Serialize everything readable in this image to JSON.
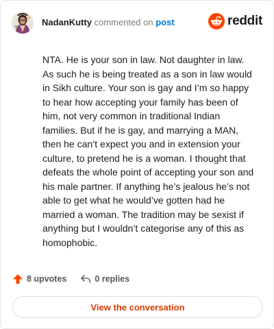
{
  "header": {
    "username": "NadanKutty",
    "verb": "commented on",
    "target": "post",
    "brand": "reddit"
  },
  "comment": {
    "body": "NTA. He is your son in law. Not daughter in law. As such he is being treated as a son in law would in Sikh culture. Your son is gay and I’m so happy to hear how accepting your family has been of him, not very common in traditional Indian families. But if he is gay, and marrying a MAN, then he can’t expect you and in extension your culture, to pretend he is a woman. I thought that defeats the whole point of accepting your son and his male partner. If anything he’s jealous he’s not able to get what he would’ve gotten had he married a woman. The tradition may be sexist if anything but I wouldn’t categorise any of this as homophobic."
  },
  "actions": {
    "upvotes": "8 upvotes",
    "replies": "0 replies",
    "view_conversation": "View the conversation"
  },
  "colors": {
    "brand_orange": "#ff4500",
    "link_blue": "#0079d3",
    "cta_text": "#d93a00",
    "upvote": "#ff4500"
  },
  "icons": [
    "avatar",
    "reddit-logo-icon",
    "upvote-arrow-icon",
    "reply-arrow-icon"
  ]
}
